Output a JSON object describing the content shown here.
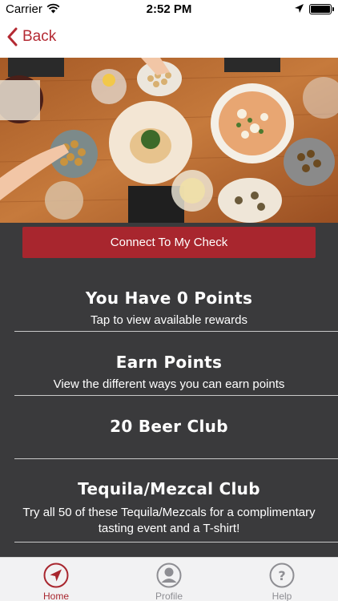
{
  "status_bar": {
    "carrier": "Carrier",
    "time": "2:52 PM"
  },
  "nav": {
    "back_label": "Back"
  },
  "colors": {
    "brand": "#a8262e",
    "panel": "#3a3a3c",
    "tab_inactive": "#8e8e93"
  },
  "actions": {
    "connect_label": "Connect To My Check"
  },
  "menu": [
    {
      "title": "You Have 0 Points",
      "subtitle": "Tap to view available rewards"
    },
    {
      "title": "Earn Points",
      "subtitle": "View the different ways you can earn points"
    },
    {
      "title": "20 Beer Club",
      "subtitle": ""
    },
    {
      "title": "Tequila/Mezcal Club",
      "subtitle": "Try all 50 of these Tequila/Mezcals for a complimentary tasting event and a T-shirt!"
    }
  ],
  "tabs": [
    {
      "label": "Home",
      "icon": "navigation-arrow-icon",
      "active": true
    },
    {
      "label": "Profile",
      "icon": "person-icon",
      "active": false
    },
    {
      "label": "Help",
      "icon": "question-mark-icon",
      "active": false
    }
  ]
}
